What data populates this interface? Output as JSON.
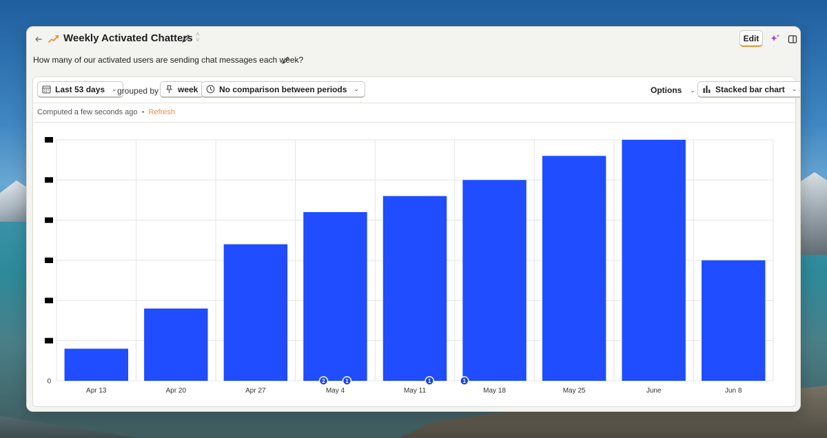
{
  "window": {
    "title": "Weekly Activated Chatters",
    "description": "How many of our activated users are sending chat messages each week?",
    "edit_label": "Edit"
  },
  "icons": {
    "back": "back-arrow-icon",
    "trend": "trend-line-icon",
    "title_edit": "pencil-icon",
    "sort": "sort-icon",
    "ai": "sparkle-icon",
    "panel": "sidebar-panel-icon",
    "calendar": "calendar-icon",
    "pin": "pin-icon",
    "clock": "clock-icon",
    "chart": "bar-chart-icon"
  },
  "toolbar": {
    "date_range": "Last 53 days",
    "grouped_by_label": "grouped by",
    "interval": "week",
    "comparison": "No comparison between periods",
    "options_label": "Options",
    "chart_type_label": "Stacked bar chart"
  },
  "status": {
    "computed_text": "Computed a few seconds ago",
    "separator": "•",
    "refresh_label": "Refresh"
  },
  "colors": {
    "bar": "#1f4dff",
    "accent": "#e0922d",
    "refresh": "#f0904a"
  },
  "chart_data": {
    "type": "bar",
    "stacked": true,
    "categories": [
      "Apr 13",
      "Apr 20",
      "Apr 27",
      "May 4",
      "May 11",
      "May 18",
      "May 25",
      "June",
      "Jun 8"
    ],
    "series": [
      {
        "values": [
          0.8,
          1.8,
          3.4,
          4.2,
          4.6,
          5.0,
          5.6,
          6.0,
          3.0
        ]
      }
    ],
    "ylim": [
      0,
      6
    ],
    "y_ticks": [
      "0",
      "",
      "",
      "",
      "",
      "",
      ""
    ],
    "y_ticks_redacted": true,
    "grid": true,
    "annotations": [
      {
        "category": "May 4",
        "label": "2"
      },
      {
        "category": "May 4",
        "label": "1"
      },
      {
        "category": "May 11",
        "label": "1"
      },
      {
        "category": "May 18",
        "label": "1"
      }
    ]
  }
}
